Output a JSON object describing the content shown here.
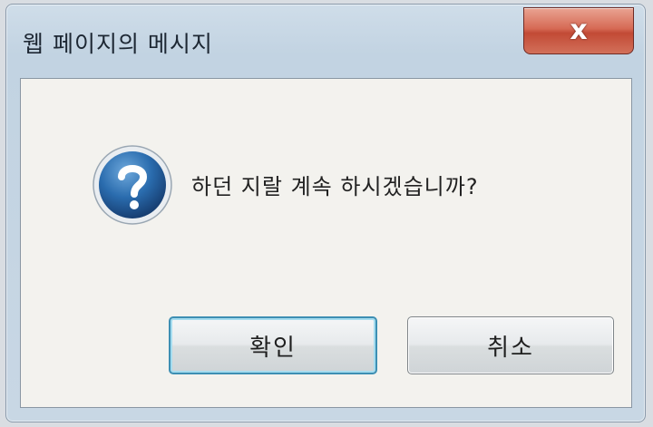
{
  "dialog": {
    "title": "웹 페이지의 메시지",
    "close_label": "x",
    "icon": "question-icon",
    "message": "하던 지랄 계속 하시겠습니까?",
    "ok_label": "확인",
    "cancel_label": "취소"
  },
  "colors": {
    "close_button": "#c95a45",
    "ok_border": "#3d8fb3",
    "icon_blue": "#1f5fa0"
  }
}
